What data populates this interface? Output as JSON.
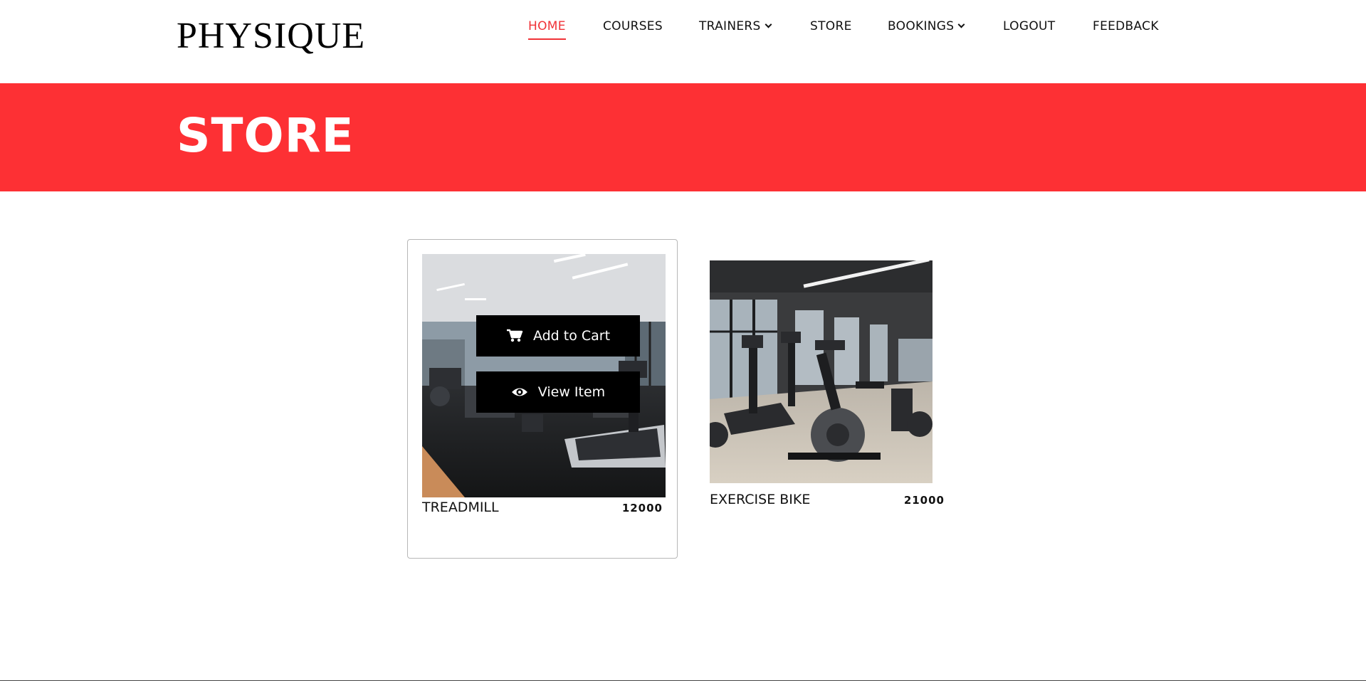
{
  "brand": {
    "logo_text": "PHYSIQUE"
  },
  "nav": {
    "items": [
      {
        "label": "HOME",
        "active": true,
        "dropdown": false
      },
      {
        "label": "COURSES",
        "active": false,
        "dropdown": false
      },
      {
        "label": "TRAINERS",
        "active": false,
        "dropdown": true
      },
      {
        "label": "STORE",
        "active": false,
        "dropdown": false
      },
      {
        "label": "BOOKINGS",
        "active": false,
        "dropdown": true
      },
      {
        "label": "LOGOUT",
        "active": false,
        "dropdown": false
      },
      {
        "label": "FEEDBACK",
        "active": false,
        "dropdown": false
      }
    ]
  },
  "banner": {
    "title": "STORE"
  },
  "products": [
    {
      "name": "TREADMILL",
      "price": "12000",
      "image_icon": "gym-treadmill-photo",
      "actions": {
        "add_to_cart": "Add to Cart",
        "view_item": "View Item"
      }
    },
    {
      "name": "EXERCISE BIKE",
      "price": "21000",
      "image_icon": "gym-exercise-bike-photo"
    }
  ],
  "colors": {
    "accent": "#fd3034",
    "nav_active": "#f03237",
    "overlay_button": "#000000"
  }
}
